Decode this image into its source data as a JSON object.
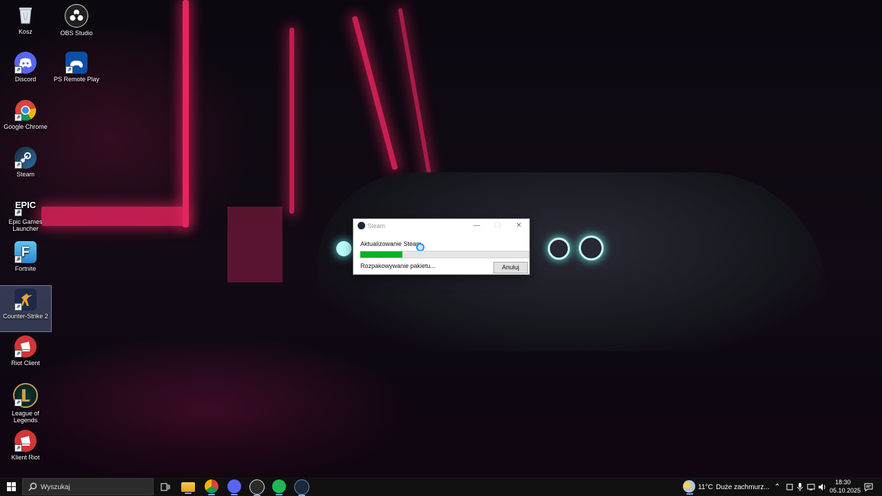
{
  "desktop": {
    "icons": [
      {
        "label": "Kosz",
        "icon": "recycle-bin-icon"
      },
      {
        "label": "OBS Studio",
        "icon": "obs-icon"
      },
      {
        "label": "Discord",
        "icon": "discord-icon"
      },
      {
        "label": "PS Remote Play",
        "icon": "ps-remote-play-icon"
      },
      {
        "label": "Google Chrome",
        "icon": "chrome-icon"
      },
      {
        "label": "Steam",
        "icon": "steam-icon"
      },
      {
        "label": "Epic Games Launcher",
        "icon": "epic-games-icon",
        "glyph_text": "EPIC"
      },
      {
        "label": "Fortnite",
        "icon": "fortnite-icon",
        "glyph_text": "F"
      },
      {
        "label": "Counter-Strike 2",
        "icon": "counter-strike-icon"
      },
      {
        "label": "Riot Client",
        "icon": "riot-client-icon"
      },
      {
        "label": "League of Legends",
        "icon": "league-of-legends-icon"
      },
      {
        "label": "Klient Riot",
        "icon": "riot-client-icon"
      }
    ]
  },
  "dialog": {
    "title": "Steam",
    "status": "Aktualizowanie Steam",
    "substatus": "Rozpakowywanie pakietu...",
    "progress_fraction": 0.25,
    "cancel_label": "Anuluj",
    "minimize_glyph": "—",
    "maximize_glyph": "☐",
    "close_glyph": "✕"
  },
  "taskbar": {
    "search_placeholder": "Wyszukaj",
    "apps": [
      "task-view-icon",
      "file-explorer-icon",
      "chrome-icon",
      "discord-icon",
      "obs-icon",
      "spotify-icon",
      "steam-icon"
    ],
    "weather": {
      "temp": "11°C",
      "desc": "Duże zachmurz..."
    },
    "time": "18:30",
    "date": "05.10.2025"
  },
  "colors": {
    "progress": "#06b025",
    "taskbar": "#101010",
    "neon": "#e8245e"
  }
}
